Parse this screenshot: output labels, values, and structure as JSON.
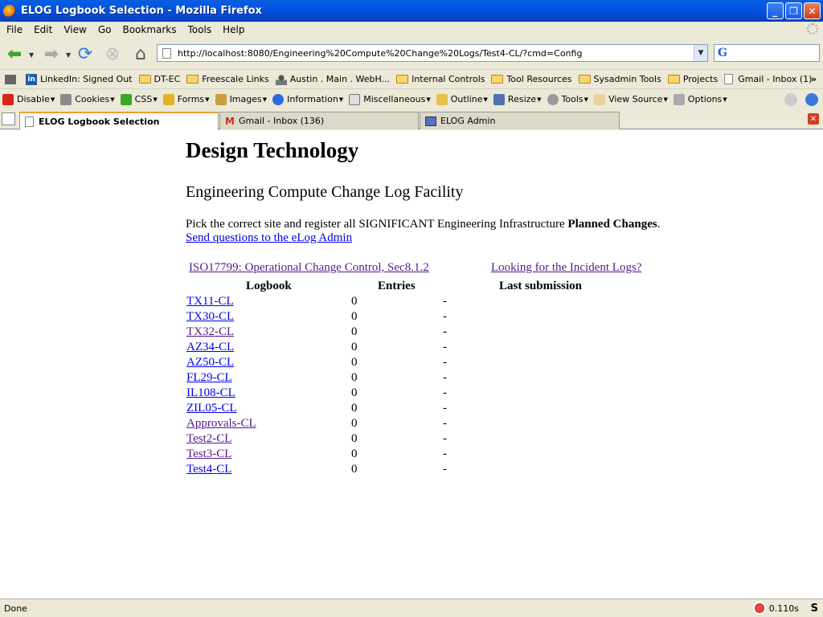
{
  "window": {
    "title": "ELOG Logbook Selection - Mozilla Firefox"
  },
  "menubar": {
    "items": [
      "File",
      "Edit",
      "View",
      "Go",
      "Bookmarks",
      "Tools",
      "Help"
    ]
  },
  "navbar": {
    "url": "http://localhost:8080/Engineering%20Compute%20Change%20Logs/Test4-CL/?cmd=Config",
    "search_engine_icon": "G"
  },
  "bookmarks": {
    "items": [
      {
        "label": "LinkedIn: Signed Out",
        "icon": "linkedin-icon"
      },
      {
        "label": "DT-EC",
        "icon": "folder-icon"
      },
      {
        "label": "Freescale Links",
        "icon": "folder-icon"
      },
      {
        "label": "Austin . Main . WebH...",
        "icon": "person-icon"
      },
      {
        "label": "Internal Controls",
        "icon": "folder-icon"
      },
      {
        "label": "Tool Resources",
        "icon": "folder-icon"
      },
      {
        "label": "Sysadmin Tools",
        "icon": "folder-icon"
      },
      {
        "label": "Projects",
        "icon": "folder-icon"
      },
      {
        "label": "Gmail - Inbox (1)",
        "icon": "page-icon"
      }
    ],
    "more": "»"
  },
  "devbar": {
    "items": [
      "Disable",
      "Cookies",
      "CSS",
      "Forms",
      "Images",
      "Information",
      "Miscellaneous",
      "Outline",
      "Resize",
      "Tools",
      "View Source",
      "Options"
    ]
  },
  "tabs": [
    {
      "label": "ELOG Logbook Selection",
      "active": true
    },
    {
      "label": "Gmail - Inbox (136)",
      "active": false
    },
    {
      "label": "ELOG Admin",
      "active": false
    }
  ],
  "page": {
    "heading": "Design Technology",
    "subheading": "Engineering Compute Change Log Facility",
    "intro_text": "Pick the correct site and register all SIGNIFICANT Engineering Infrastructure ",
    "intro_bold": "Planned Changes",
    "intro_end": ".",
    "admin_link": "Send questions to the eLog Admin",
    "iso_link": "ISO17799: Operational Change Control, Sec8.1.2",
    "incident_link": "Looking for the Incident Logs?",
    "columns": {
      "logbook": "Logbook",
      "entries": "Entries",
      "last": "Last submission"
    },
    "logbooks": [
      {
        "name": "TX11-CL",
        "entries": "0",
        "last": "-",
        "visited": false
      },
      {
        "name": "TX30-CL",
        "entries": "0",
        "last": "-",
        "visited": false
      },
      {
        "name": "TX32-CL",
        "entries": "0",
        "last": "-",
        "visited": true
      },
      {
        "name": "AZ34-CL",
        "entries": "0",
        "last": "-",
        "visited": false
      },
      {
        "name": "AZ50-CL",
        "entries": "0",
        "last": "-",
        "visited": false
      },
      {
        "name": "FL29-CL",
        "entries": "0",
        "last": "-",
        "visited": false
      },
      {
        "name": "IL108-CL",
        "entries": "0",
        "last": "-",
        "visited": false
      },
      {
        "name": "ZIL05-CL",
        "entries": "0",
        "last": "-",
        "visited": false
      },
      {
        "name": "Approvals-CL",
        "entries": "0",
        "last": "-",
        "visited": true
      },
      {
        "name": "Test2-CL",
        "entries": "0",
        "last": "-",
        "visited": true
      },
      {
        "name": "Test3-CL",
        "entries": "0",
        "last": "-",
        "visited": true
      },
      {
        "name": "Test4-CL",
        "entries": "0",
        "last": "-",
        "visited": false
      }
    ]
  },
  "status": {
    "text": "Done",
    "timer": "0.110s"
  }
}
